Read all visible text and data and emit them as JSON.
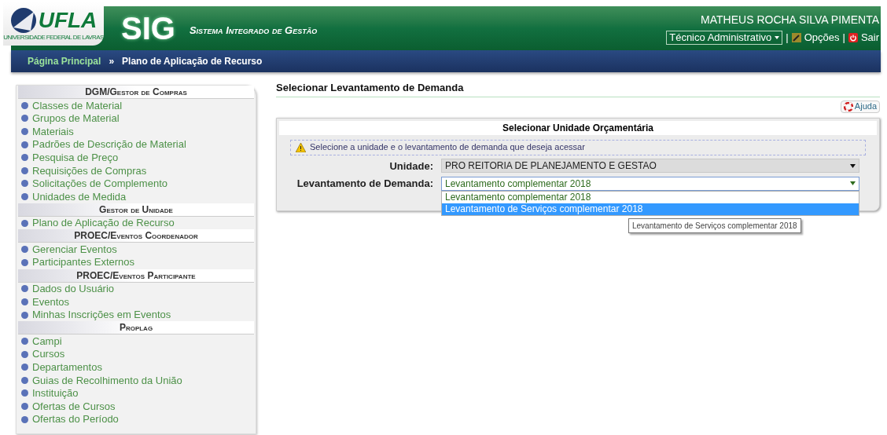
{
  "header": {
    "logo_text": "UFLA",
    "logo_caption": "UNIVERSIDADE FEDERAL DE LAVRAS",
    "app_name": "SIG",
    "app_subtitle": "Sistema Integrado de Gestão",
    "user_name": "MATHEUS ROCHA SILVA PIMENTA",
    "role": "Técnico Administrativo",
    "options_link": "Opções",
    "exit_link": "Sair",
    "separator": "|"
  },
  "breadcrumb": {
    "home": "Página Principal",
    "separator": "»",
    "current": "Plano de Aplicação de Recurso"
  },
  "sidebar": [
    {
      "title": "DGM/Gestor de Compras",
      "items": [
        "Classes de Material",
        "Grupos de Material",
        "Materiais",
        "Padrões de Descrição de Material",
        "Pesquisa de Preço",
        "Requisições de Compras",
        "Solicitações de Complemento",
        "Unidades de Medida"
      ]
    },
    {
      "title": "Gestor de Unidade",
      "items": [
        "Plano de Aplicação de Recurso"
      ]
    },
    {
      "title": "PROEC/Eventos Coordenador",
      "items": [
        "Gerenciar Eventos",
        "Participantes Externos"
      ]
    },
    {
      "title": "PROEC/Eventos Participante",
      "items": [
        "Dados do Usuário",
        "Eventos",
        "Minhas Inscrições em Eventos"
      ]
    },
    {
      "title": "Proplag",
      "items": [
        "Campi",
        "Cursos",
        "Departamentos",
        "Guias de Recolhimento da União",
        "Instituição",
        "Ofertas de Cursos",
        "Ofertas do Período"
      ]
    }
  ],
  "main": {
    "title": "Selecionar Levantamento de Demanda",
    "help_button": "Ajuda",
    "form": {
      "title": "Selecionar Unidade Orçamentária",
      "notice": "Selecione a unidade e o levantamento de demanda que deseja acessar",
      "fields": [
        {
          "label": "Unidade:",
          "value": "PRO REITORIA DE PLANEJAMENTO E GESTAO",
          "disabled": true,
          "expanded": false
        },
        {
          "label": "Levantamento de Demanda:",
          "value": "Levantamento complementar 2018",
          "disabled": false,
          "expanded": true,
          "options": [
            {
              "label": "Levantamento complementar 2018",
              "highlighted": false
            },
            {
              "label": "Levantamento de Serviços complementar 2018",
              "highlighted": true
            }
          ]
        }
      ]
    },
    "tooltip": "Levantamento de Serviços complementar 2018"
  }
}
